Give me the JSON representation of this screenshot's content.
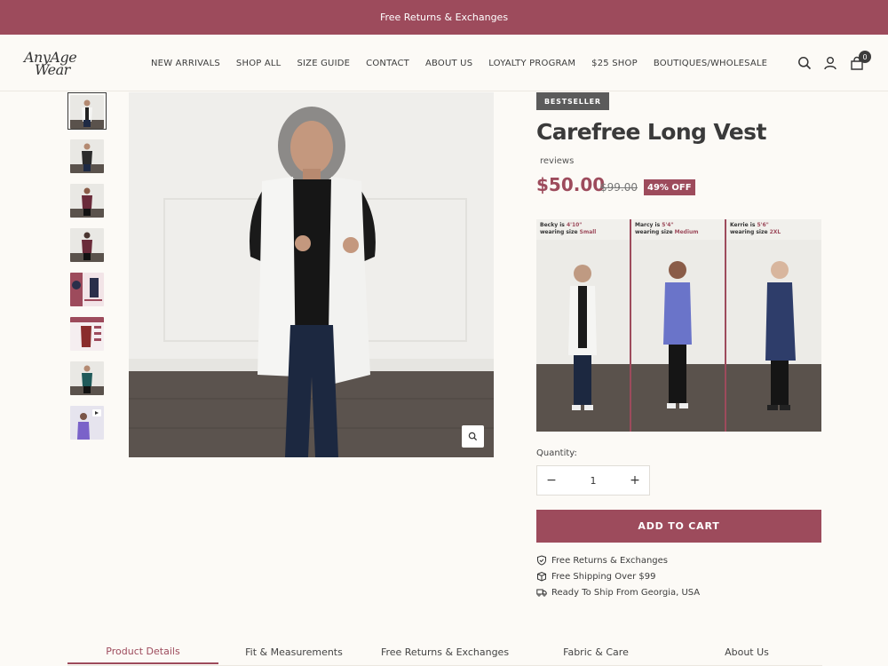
{
  "promo": {
    "text": "Free Returns & Exchanges"
  },
  "header": {
    "logo_line1": "AnyAge",
    "logo_line2": "Wear",
    "nav": [
      "NEW ARRIVALS",
      "SHOP ALL",
      "SIZE GUIDE",
      "CONTACT",
      "ABOUT US",
      "LOYALTY PROGRAM",
      "$25 SHOP",
      "BOUTIQUES/WHOLESALE"
    ],
    "cart_count": "0",
    "icons": [
      "search-icon",
      "account-icon",
      "cart-icon"
    ]
  },
  "gallery": {
    "thumb_count": 8,
    "selected_index": 0
  },
  "product": {
    "badge": "BESTSELLER",
    "title": "Carefree Long Vest",
    "reviews": "reviews",
    "price": "$50.00",
    "compare_price": "$99.00",
    "discount": "49% OFF"
  },
  "size_chart": {
    "models": [
      {
        "name": "Becky",
        "height": "4'10\"",
        "size": "Small",
        "garment_color": "#f4f4f2"
      },
      {
        "name": "Marcy",
        "height": "5'4\"",
        "size": "Medium",
        "garment_color": "#6a74c9"
      },
      {
        "name": "Kerrie",
        "height": "5'6\"",
        "size": "2XL",
        "garment_color": "#2e3d6a"
      }
    ],
    "is_text": "is",
    "wearing_text": "wearing size"
  },
  "quantity": {
    "label": "Quantity:",
    "value": "1",
    "minus": "−",
    "plus": "+"
  },
  "add_to_cart": "ADD TO CART",
  "features": [
    {
      "icon": "shield-check-icon",
      "text": "Free Returns & Exchanges"
    },
    {
      "icon": "box-icon",
      "text": "Free Shipping Over $99"
    },
    {
      "icon": "truck-icon",
      "text": "Ready To Ship From Georgia, USA"
    }
  ],
  "tabs": [
    "Product Details",
    "Fit & Measurements",
    "Free Returns & Exchanges",
    "Fabric & Care",
    "About Us"
  ],
  "active_tab": 0,
  "colors": {
    "accent": "#9d4b5c",
    "badge": "#5b5b5b",
    "background": "#fcfaf6"
  }
}
